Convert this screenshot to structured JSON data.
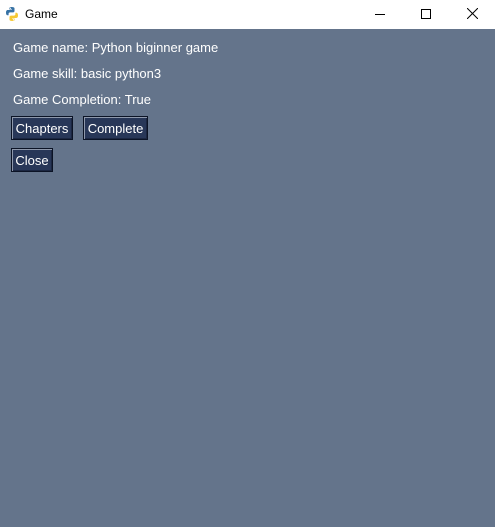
{
  "window": {
    "title": "Game",
    "app_icon": "python-icon",
    "controls": {
      "minimize_icon": "minimize-icon",
      "maximize_icon": "maximize-icon",
      "close_icon": "close-icon"
    }
  },
  "info": {
    "game_name": "Game name: Python biginner game",
    "game_skill": "Game skill: basic python3",
    "game_completion": "Game Completion: True"
  },
  "buttons": {
    "chapters": "Chapters",
    "complete": "Complete",
    "close": "Close"
  },
  "colors": {
    "background": "#64748b",
    "button_bg": "#283758",
    "text": "#ffffff",
    "titlebar": "#ffffff"
  }
}
